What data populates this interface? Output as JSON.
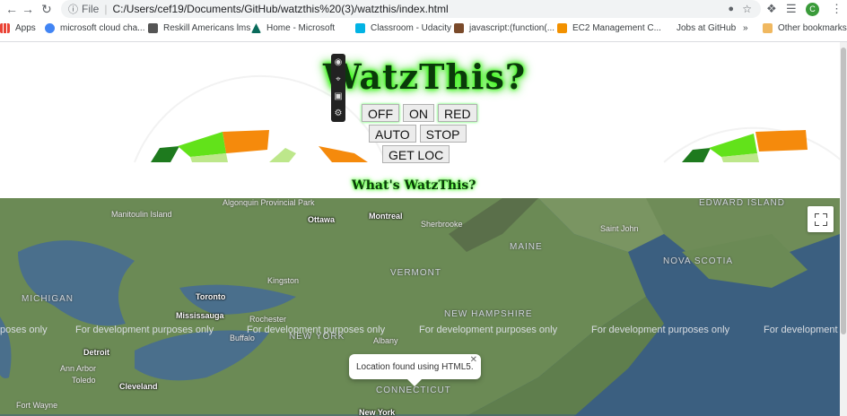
{
  "browser": {
    "url_prefix": "File",
    "url": "C:/Users/cef19/Documents/GitHub/watzthis%20(3)/watzthis/index.html",
    "bookmarks": [
      {
        "label": "Apps",
        "color": "#ea4335"
      },
      {
        "label": "microsoft cloud cha...",
        "color": "#4285f4"
      },
      {
        "label": "Reskill Americans lms",
        "color": "#555555"
      },
      {
        "label": "Home - Microsoft",
        "color": "#0a6b5b"
      },
      {
        "label": "Classroom - Udacity",
        "color": "#02b3e4"
      },
      {
        "label": "javascript:(function(...",
        "color": "#7a4a2a"
      },
      {
        "label": "EC2 Management C...",
        "color": "#f29100"
      },
      {
        "label": "Jobs at GitHub",
        "color": "#ffffff"
      }
    ],
    "more_bookmarks": "»",
    "other_bookmarks": "Other bookmarks",
    "avatar_letter": "C"
  },
  "page": {
    "logo": "WatzThis?",
    "buttons_row1": [
      "OFF",
      "ON",
      "RED"
    ],
    "buttons_row2": [
      "AUTO",
      "STOP"
    ],
    "buttons_row3": [
      "GET LOC"
    ],
    "tagline": "What's WatzThis?"
  },
  "map": {
    "watermark": "For development purposes only",
    "watermark_partial_left": "poses only",
    "watermark_partial_right": "For development",
    "infowindow": "Location found using HTML5.",
    "labels": {
      "algonquin": "Algonquin Provincial Park",
      "ottawa": "Ottawa",
      "montreal": "Montreal",
      "sherbrooke": "Sherbrooke",
      "saint_john": "Saint John",
      "edward_island": "EDWARD ISLAND",
      "maine": "MAINE",
      "nova_scotia": "NOVA SCOTIA",
      "vermont": "VERMONT",
      "kingston": "Kingston",
      "toronto": "Toronto",
      "mississauga": "Mississauga",
      "michigan": "MICHIGAN",
      "manitoulin": "Manitoulin Island",
      "rochester": "Rochester",
      "buffalo": "Buffalo",
      "new_york": "NEW YORK",
      "new_hampshire": "NEW HAMPSHIRE",
      "albany": "Albany",
      "detroit": "Detroit",
      "ann_arbor": "Ann Arbor",
      "cleveland": "Cleveland",
      "toledo": "Toledo",
      "connecticut": "CONNECTICUT",
      "fort_wayne": "Fort Wayne",
      "new_york_city": "New York"
    }
  },
  "colors": {
    "neon": "#39ff14",
    "map_water": "#3b5f80",
    "map_land": "#6b8a55"
  }
}
